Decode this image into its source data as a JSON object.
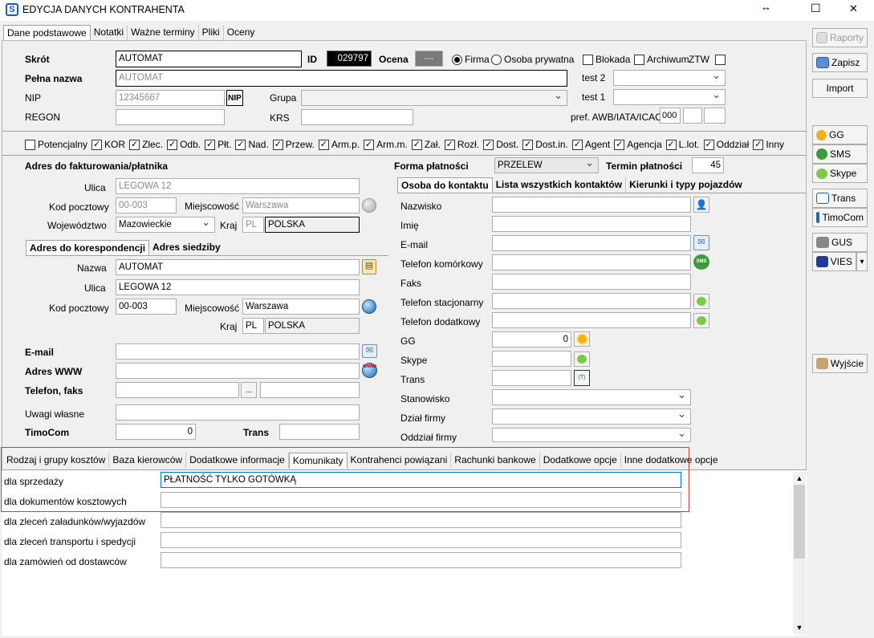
{
  "window": {
    "title": "EDYCJA DANYCH KONTRAHENTA",
    "logo_letter": "S",
    "resize_glyph": "↔",
    "maximize_glyph": "☐",
    "close_glyph": "✕"
  },
  "top_tabs": [
    "Dane podstawowe",
    "Notatki",
    "Ważne terminy",
    "Pliki",
    "Oceny"
  ],
  "basic": {
    "skrot_label": "Skrót",
    "skrot": "AUTOMAT",
    "id_label": "ID",
    "id": "029797",
    "ocena_label": "Ocena",
    "ocena": "---",
    "firma": "Firma",
    "osoba": "Osoba prywatna",
    "blokada": "Blokada",
    "archiwum": "Archiwum",
    "ztw": "ZTW",
    "pelna_label": "Pełna nazwa",
    "pelna": "AUTOMAT",
    "test2": "test 2",
    "test1": "test 1",
    "nip_label": "NIP",
    "nip": "12345667",
    "nip_btn": "NIP",
    "grupa_label": "Grupa",
    "regon_label": "REGON",
    "krs_label": "KRS",
    "pref_label": "pref. AWB/IATA/ICAO",
    "pref": "000"
  },
  "roles": [
    {
      "label": "Potencjalny",
      "checked": false
    },
    {
      "label": "KOR",
      "checked": true
    },
    {
      "label": "Zlec.",
      "checked": true
    },
    {
      "label": "Odb.",
      "checked": true
    },
    {
      "label": "Płt.",
      "checked": true
    },
    {
      "label": "Nad.",
      "checked": true
    },
    {
      "label": "Przew.",
      "checked": true
    },
    {
      "label": "Arm.p.",
      "checked": true
    },
    {
      "label": "Arm.m.",
      "checked": true
    },
    {
      "label": "Zał.",
      "checked": true
    },
    {
      "label": "Rozł.",
      "checked": true
    },
    {
      "label": "Dost.",
      "checked": true
    },
    {
      "label": "Dost.in.",
      "checked": true
    },
    {
      "label": "Agent",
      "checked": true
    },
    {
      "label": "Agencja",
      "checked": true
    },
    {
      "label": "L.lot.",
      "checked": true
    },
    {
      "label": "Oddział",
      "checked": true
    },
    {
      "label": "Inny",
      "checked": true
    }
  ],
  "billing": {
    "title": "Adres do fakturowania/płatnika",
    "ulica_label": "Ulica",
    "ulica": "LEGOWA 12",
    "kod_label": "Kod pocztowy",
    "kod": "00-003",
    "miejsc_label": "Miejscowość",
    "miejsc": "Warszawa",
    "woj_label": "Województwo",
    "woj": "Mazowieckie",
    "kraj_label": "Kraj",
    "kraj_code": "PL",
    "kraj": "POLSKA"
  },
  "corr_tabs": [
    "Adres do korespondencji",
    "Adres siedziby"
  ],
  "corr": {
    "nazwa_label": "Nazwa",
    "nazwa": "AUTOMAT",
    "ulica_label": "Ulica",
    "ulica": "LEGOWA 12",
    "kod_label": "Kod pocztowy",
    "kod": "00-003",
    "miejsc_label": "Miejscowość",
    "miejsc": "Warszawa",
    "kraj_label": "Kraj",
    "kraj_code": "PL",
    "kraj": "POLSKA"
  },
  "contact": {
    "email_label": "E-mail",
    "www_label": "Adres WWW",
    "tel_label": "Telefon, faks",
    "tel_btn": "...",
    "uwagi_label": "Uwagi własne",
    "timocom_label": "TimoCom",
    "timocom": "0",
    "trans_label": "Trans"
  },
  "payment": {
    "forma_label": "Forma płatności",
    "forma": "PRZELEW",
    "termin_label": "Termin płatności",
    "termin": "45"
  },
  "person_tabs": [
    "Osoba do kontaktu",
    "Lista wszystkich kontaktów",
    "Kierunki i typy pojazdów"
  ],
  "person": {
    "nazwisko": "Nazwisko",
    "imie": "Imię",
    "email": "E-mail",
    "tel_kom": "Telefon komórkowy",
    "faks": "Faks",
    "tel_stac": "Telefon stacjonarny",
    "tel_dod": "Telefon dodatkowy",
    "gg": "GG",
    "gg_value": "0",
    "skype": "Skype",
    "trans": "Trans",
    "stanowisko": "Stanowisko",
    "dzial": "Dział firmy",
    "oddzial": "Oddział firmy"
  },
  "bottom_tabs": [
    "Rodzaj i grupy kosztów",
    "Baza kierowców",
    "Dodatkowe informacje",
    "Komunikaty",
    "Kontrahenci powiązani",
    "Rachunki bankowe",
    "Dodatkowe opcje",
    "Inne dodatkowe opcje"
  ],
  "messages": [
    {
      "label": "dla sprzedaży",
      "value": "PŁATNOŚĆ TYLKO GOTÓWKĄ"
    },
    {
      "label": "dla dokumentów kosztowych",
      "value": ""
    },
    {
      "label": "dla zleceń załadunków/wyjazdów",
      "value": ""
    },
    {
      "label": "dla zleceń transportu i spedycji",
      "value": ""
    },
    {
      "label": "dla zamówień od dostawców",
      "value": ""
    }
  ],
  "side": {
    "raporty": "Raporty",
    "zapisz": "Zapisz",
    "import": "Import",
    "gg": "GG",
    "sms": "SMS",
    "skype": "Skype",
    "trans": "Trans",
    "timocom": "TimoCom",
    "gus": "GUS",
    "vies": "VIES",
    "wyjscie": "Wyjście",
    "dd_arrow": "▾"
  },
  "icon_glyphs": {
    "sms": "SMS",
    "www": "www",
    "trans": "(T)",
    "person": "👤",
    "doc": "▤",
    "mail": "✉"
  },
  "colors": {
    "highlight_border": "#d23a3a",
    "accent": "#0078d7"
  }
}
